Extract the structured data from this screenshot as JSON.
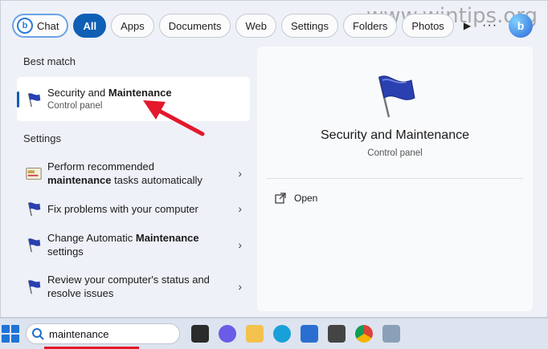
{
  "watermark": "www.wintips.org",
  "filters": {
    "chat": "Chat",
    "all": "All",
    "apps": "Apps",
    "documents": "Documents",
    "web": "Web",
    "settings": "Settings",
    "folders": "Folders",
    "photos": "Photos",
    "more": "···"
  },
  "sections": {
    "best_match": "Best match",
    "settings": "Settings"
  },
  "best_match": {
    "title_prefix": "Security and ",
    "title_bold": "Maintenance",
    "subtitle": "Control panel"
  },
  "settings_items": [
    {
      "line1": "Perform recommended",
      "bold": "maintenance",
      "rest": " tasks automatically"
    },
    {
      "line1": "Fix problems with your computer"
    },
    {
      "pre": "Change Automatic ",
      "bold": "Maintenance",
      "line2": "settings"
    },
    {
      "line1": "Review your computer's status and",
      "line2": "resolve issues"
    }
  ],
  "detail": {
    "title": "Security and Maintenance",
    "subtitle": "Control panel",
    "open_label": "Open"
  },
  "taskbar": {
    "search_value": "maintenance"
  },
  "colors": {
    "accent": "#0f5fb5",
    "annotation": "#e3182b"
  }
}
